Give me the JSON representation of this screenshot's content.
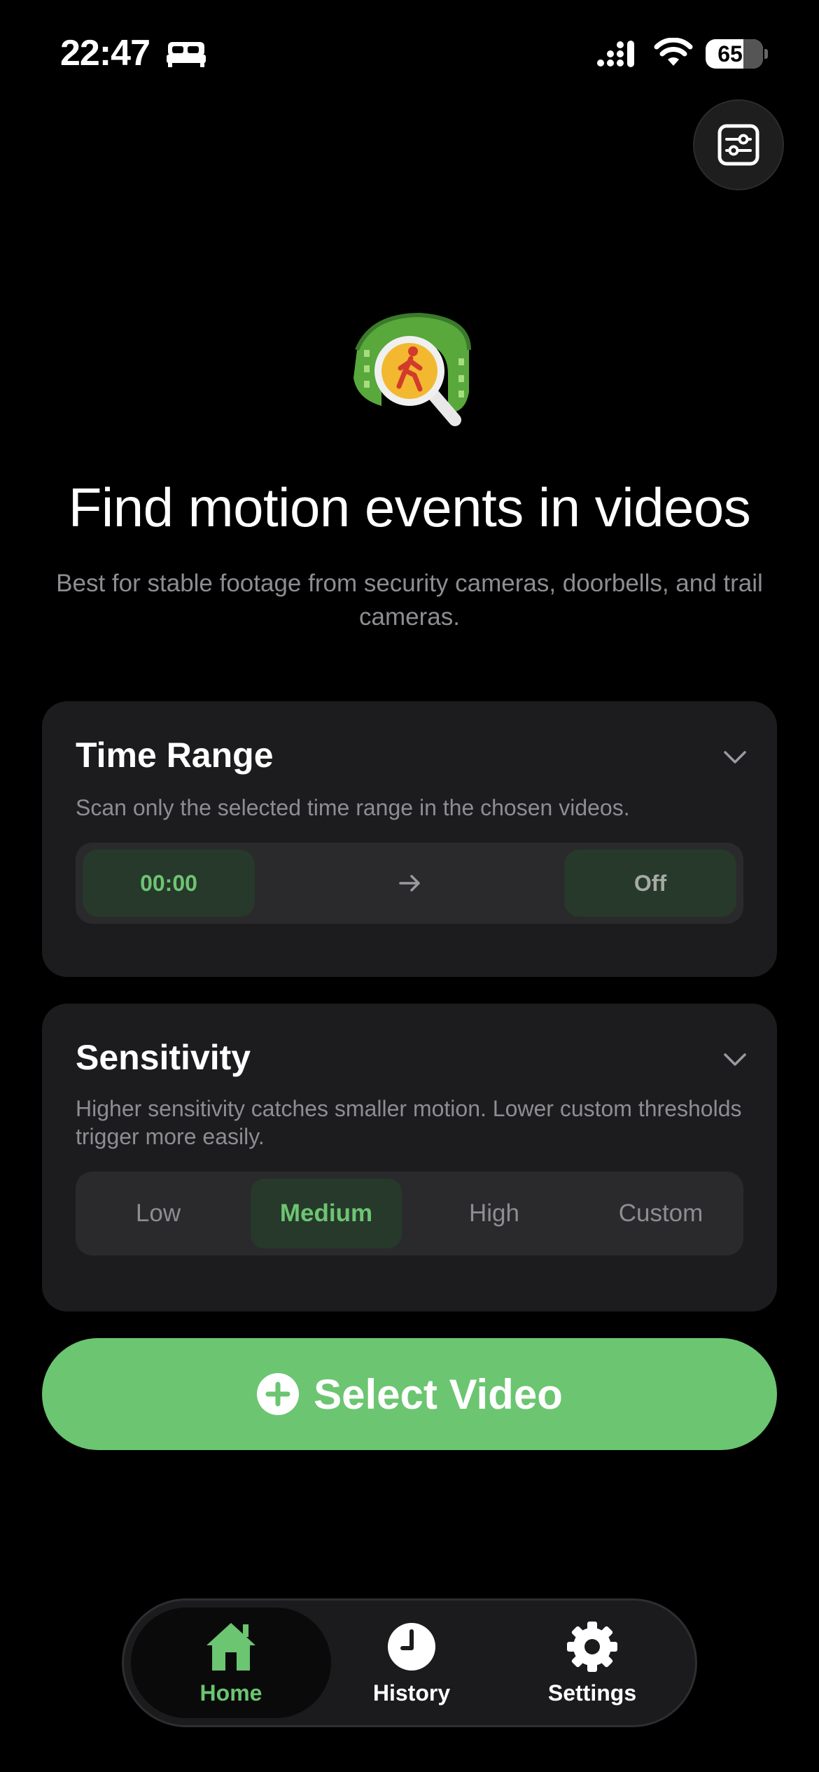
{
  "status_bar": {
    "time": "22:47",
    "battery": "65",
    "icons": [
      "bed-icon",
      "signal-icon",
      "wifi-icon",
      "battery-icon"
    ]
  },
  "toolbar": {
    "filter_icon": "sliders-icon"
  },
  "hero": {
    "logo_icon": "film-magnifier-walker-icon",
    "title": "Find motion events in videos",
    "subtitle": "Best for stable footage from security cameras, doorbells, and trail cameras."
  },
  "time_range": {
    "title": "Time Range",
    "description": "Scan only the selected time range in the chosen videos.",
    "start": "00:00",
    "end": "Off"
  },
  "sensitivity": {
    "title": "Sensitivity",
    "description": "Higher sensitivity catches smaller motion. Lower custom thresholds trigger more easily.",
    "options": [
      "Low",
      "Medium",
      "High",
      "Custom"
    ],
    "selected": "Medium"
  },
  "select_video": {
    "label": "Select Video"
  },
  "tabs": [
    {
      "label": "Home",
      "icon": "house-icon",
      "active": true
    },
    {
      "label": "History",
      "icon": "clock-icon",
      "active": false
    },
    {
      "label": "Settings",
      "icon": "gear-icon",
      "active": false
    }
  ],
  "colors": {
    "accent": "#6bc571",
    "card": "#1c1c1e",
    "muted_text": "#8d8d92"
  }
}
